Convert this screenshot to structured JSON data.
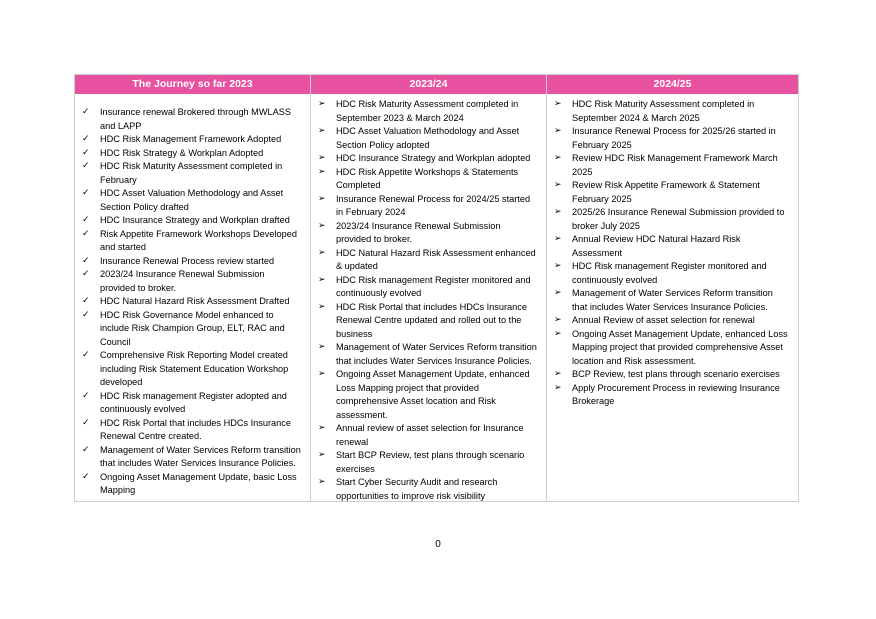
{
  "colors": {
    "header_background": "#e8519f",
    "header_text": "#ffffff"
  },
  "marker_icons": {
    "check": "check-icon",
    "arrow": "arrowhead-icon"
  },
  "columns": [
    {
      "header": "The Journey so far 2023",
      "marker": "✓",
      "items": [
        "Insurance renewal Brokered through MWLASS and LAPP",
        "HDC Risk Management Framework Adopted",
        "HDC Risk Strategy & Workplan Adopted",
        "HDC Risk Maturity Assessment completed in February",
        "HDC Asset Valuation Methodology and Asset Section Policy drafted",
        "HDC Insurance Strategy and Workplan drafted",
        "Risk Appetite Framework Workshops Developed and started",
        "Insurance Renewal Process review started",
        "2023/24 Insurance Renewal Submission provided to broker.",
        "HDC Natural Hazard Risk Assessment Drafted",
        "HDC Risk Governance Model enhanced to include Risk Champion Group, ELT, RAC and Council",
        "Comprehensive Risk Reporting Model created including Risk Statement Education Workshop developed",
        "HDC Risk management Register adopted and continuously evolved",
        "HDC Risk Portal that includes HDCs Insurance Renewal Centre created.",
        "Management of Water Services Reform transition that includes Water Services Insurance Policies.",
        "Ongoing Asset Management Update, basic Loss Mapping"
      ]
    },
    {
      "header": "2023/24",
      "marker": "➢",
      "items": [
        "HDC Risk Maturity Assessment completed in September 2023 & March 2024",
        "HDC Asset Valuation Methodology and Asset Section Policy adopted",
        "HDC Insurance Strategy and Workplan adopted",
        "HDC Risk Appetite Workshops & Statements Completed",
        "Insurance Renewal Process for 2024/25 started in February 2024",
        "2023/24 Insurance Renewal Submission provided to broker.",
        "HDC Natural Hazard Risk Assessment enhanced & updated",
        "HDC Risk management Register monitored and continuously evolved",
        "HDC Risk Portal that includes HDCs Insurance Renewal Centre updated and rolled out to the business",
        "Management of Water Services Reform transition that includes Water Services Insurance Policies.",
        "Ongoing Asset Management Update, enhanced Loss Mapping project that provided comprehensive Asset location and Risk assessment.",
        "Annual review of asset selection for Insurance renewal",
        "Start BCP Review, test plans through scenario exercises",
        "Start Cyber Security Audit and research opportunities to improve risk visibility"
      ]
    },
    {
      "header": "2024/25",
      "marker": "➢",
      "items": [
        "HDC Risk Maturity Assessment completed in September 2024 & March 2025",
        "Insurance Renewal Process for 2025/26 started in February 2025",
        "Review HDC Risk Management Framework March 2025",
        "Review Risk Appetite Framework & Statement February 2025",
        "2025/26 Insurance Renewal Submission provided to broker July 2025",
        "Annual Review HDC Natural Hazard Risk Assessment",
        "HDC Risk management Register monitored and continuously evolved",
        "Management of Water Services Reform transition that includes Water Services Insurance Policies.",
        "Annual Review of asset selection for renewal",
        "Ongoing Asset Management Update, enhanced Loss Mapping project that provided comprehensive Asset location and Risk assessment.",
        "BCP Review, test plans through scenario exercises",
        "Apply Procurement Process in reviewing Insurance Brokerage"
      ]
    }
  ],
  "page_number": "0"
}
